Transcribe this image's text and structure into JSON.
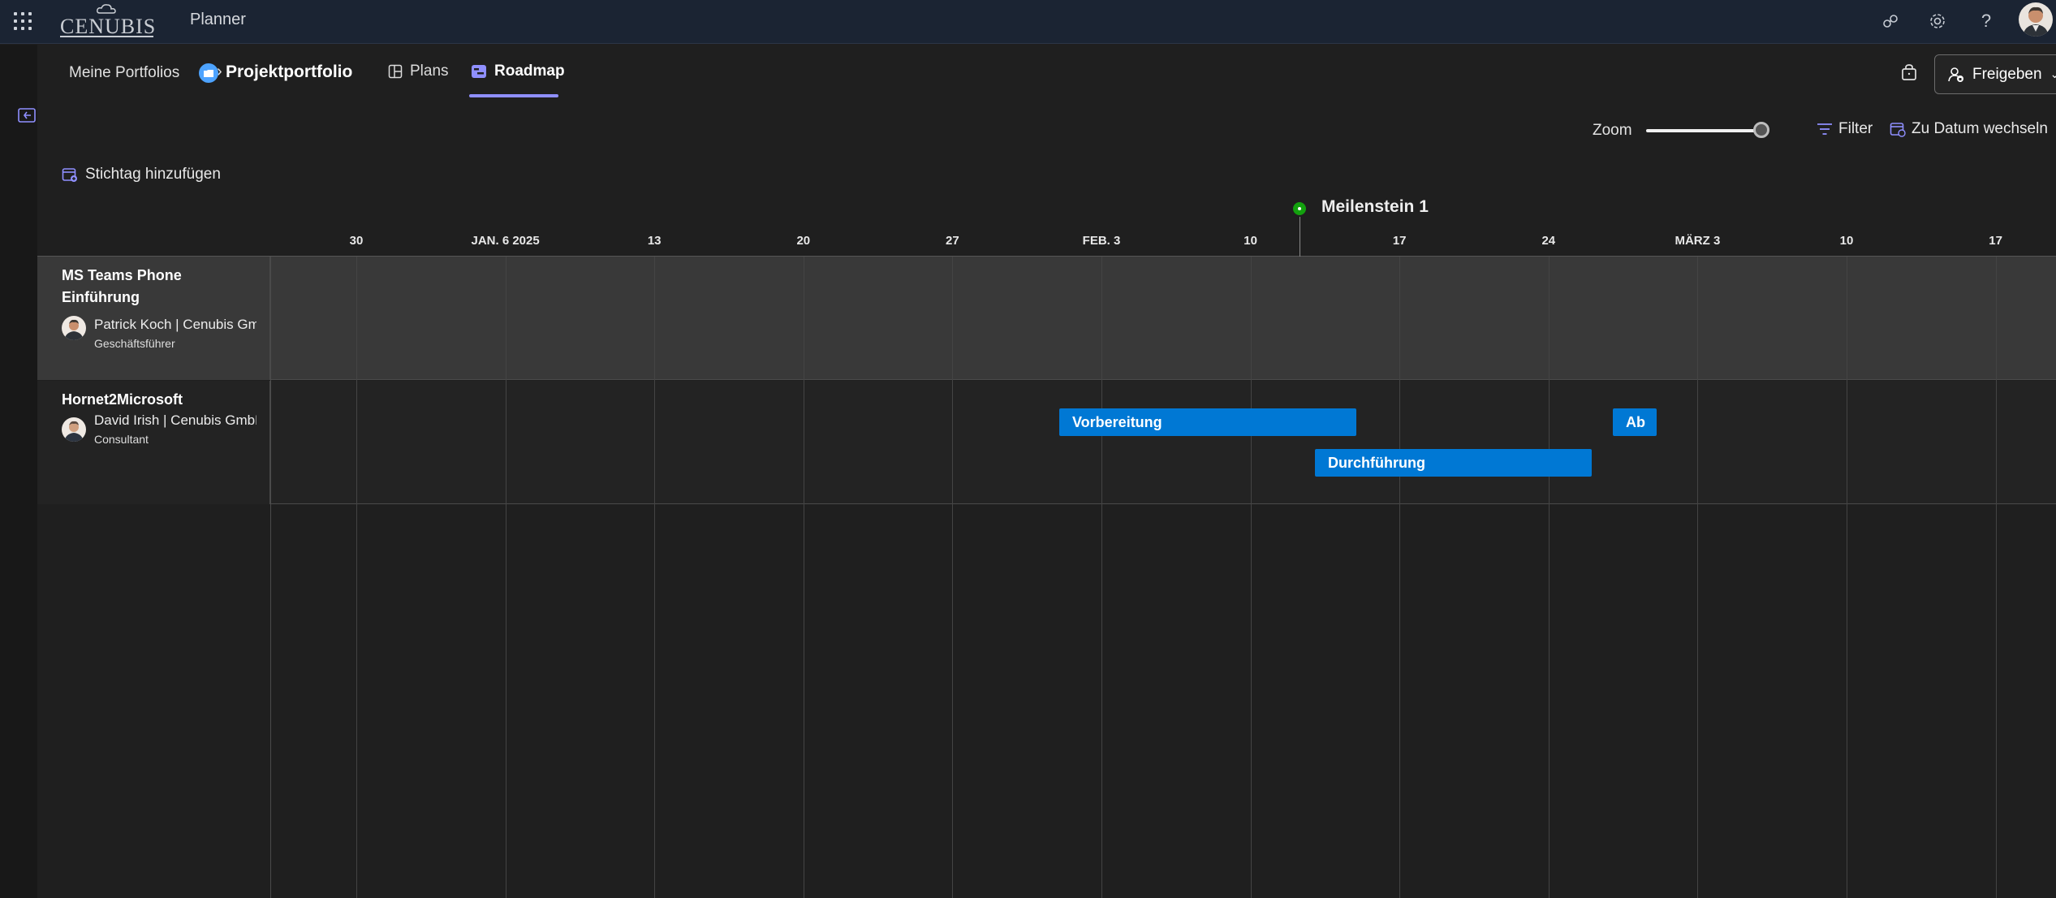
{
  "app": {
    "title": "Planner",
    "logo_text": "CENUBIS"
  },
  "breadcrumb": {
    "parent": "Meine Portfolios",
    "current": "Projektportfolio"
  },
  "tabs": [
    {
      "label": "Plans",
      "icon": "grid-icon"
    },
    {
      "label": "Roadmap",
      "icon": "roadmap-icon",
      "active": true
    }
  ],
  "header_actions": {
    "share_label": "Freigeben"
  },
  "toolbar": {
    "zoom_label": "Zoom",
    "zoom_level": 0.9,
    "filter_label": "Filter",
    "goto_date_label": "Zu Datum wechseln",
    "add_keydate_label": "Stichtag hinzufügen"
  },
  "timeline": {
    "dates": [
      "30",
      "JAN. 6 2025",
      "13",
      "20",
      "27",
      "FEB. 3",
      "10",
      "17",
      "24",
      "MÄRZ 3",
      "10",
      "17"
    ],
    "milestone": {
      "label": "Meilenstein 1",
      "color": "#13a10e"
    }
  },
  "rows": [
    {
      "title": "MS Teams Phone Einführung",
      "person": "Patrick Koch | Cenubis GmbH",
      "role": "Geschäftsführer",
      "tasks": []
    },
    {
      "title": "Hornet2Microsoft",
      "person": "David Irish | Cenubis GmbH",
      "role": "Consultant",
      "tasks": [
        {
          "label": "Vorbereitung"
        },
        {
          "label": "Durchführung"
        },
        {
          "label": "Ab"
        }
      ]
    }
  ],
  "colors": {
    "task_bar": "#0078d4",
    "accent": "#8f8fff",
    "topbar": "#1b2433"
  }
}
